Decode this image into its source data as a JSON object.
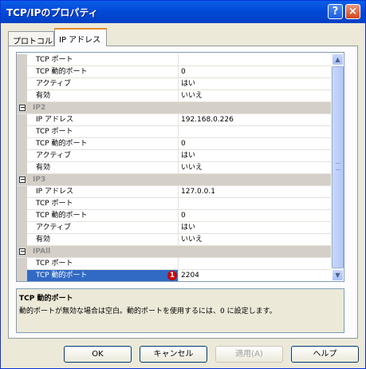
{
  "window": {
    "title": "TCP/IPのプロパティ",
    "help_label": "?",
    "close_label": "×"
  },
  "tabs": [
    {
      "label": "プロトコル"
    },
    {
      "label": "IP アドレス"
    }
  ],
  "rows": [
    {
      "type": "prop",
      "name": "TCP ポート",
      "value": ""
    },
    {
      "type": "prop",
      "name": "TCP 動的ポート",
      "value": "0"
    },
    {
      "type": "prop",
      "name": "アクティブ",
      "value": "はい"
    },
    {
      "type": "prop",
      "name": "有効",
      "value": "いいえ"
    },
    {
      "type": "cat",
      "name": "IP2",
      "toggle": "−"
    },
    {
      "type": "prop",
      "name": "IP アドレス",
      "value": "192.168.0.226"
    },
    {
      "type": "prop",
      "name": "TCP ポート",
      "value": ""
    },
    {
      "type": "prop",
      "name": "TCP 動的ポート",
      "value": "0"
    },
    {
      "type": "prop",
      "name": "アクティブ",
      "value": "はい"
    },
    {
      "type": "prop",
      "name": "有効",
      "value": "いいえ"
    },
    {
      "type": "cat",
      "name": "IP3",
      "toggle": "−"
    },
    {
      "type": "prop",
      "name": "IP アドレス",
      "value": "127.0.0.1"
    },
    {
      "type": "prop",
      "name": "TCP ポート",
      "value": ""
    },
    {
      "type": "prop",
      "name": "TCP 動的ポート",
      "value": "0"
    },
    {
      "type": "prop",
      "name": "アクティブ",
      "value": "はい"
    },
    {
      "type": "prop",
      "name": "有効",
      "value": "いいえ"
    },
    {
      "type": "cat",
      "name": "IPAll",
      "toggle": "−"
    },
    {
      "type": "prop",
      "name": "TCP ポート",
      "value": ""
    },
    {
      "type": "prop",
      "name": "TCP 動的ポート",
      "value": "2204",
      "selected": true,
      "badge": "1"
    }
  ],
  "scroll": {
    "up_icon": "▲",
    "down_icon": "▼"
  },
  "description": {
    "title": "TCP 動的ポート",
    "text": "動的ポートが無効な場合は空白。動的ポートを使用するには、0 に設定します。"
  },
  "buttons": {
    "ok": "OK",
    "cancel": "キャンセル",
    "apply": "適用(A)",
    "help": "ヘルプ"
  },
  "colors": {
    "selection": "#316ac5",
    "titlebar": "#0249d8",
    "badge": "#cc0000"
  }
}
